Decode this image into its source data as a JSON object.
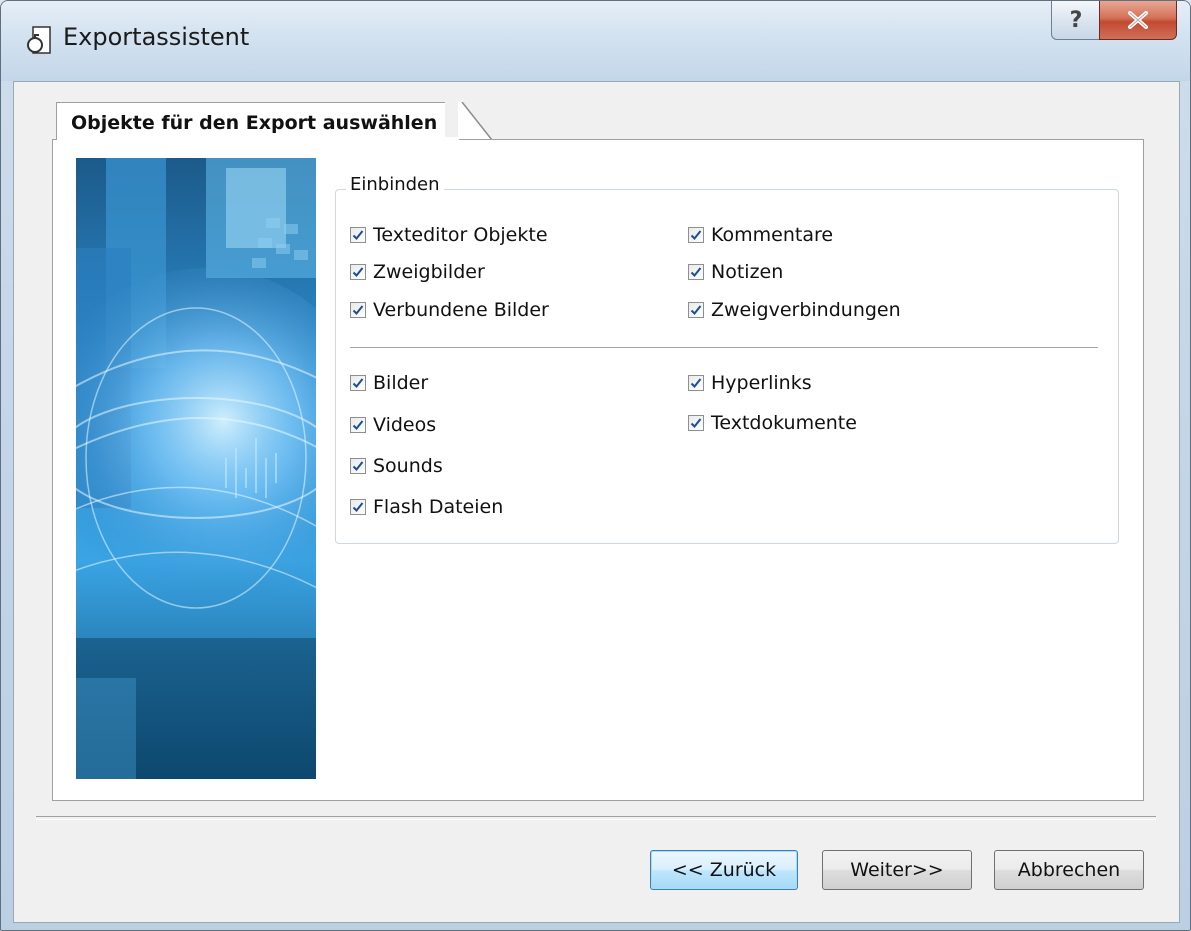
{
  "window": {
    "title": "Exportassistent",
    "help_label": "?",
    "close_label": "X"
  },
  "tab": {
    "label": "Objekte für den Export auswählen"
  },
  "group": {
    "legend": "Einbinden",
    "section1": {
      "left": [
        {
          "label": "Texteditor Objekte",
          "checked": true
        },
        {
          "label": "Zweigbilder",
          "checked": true
        },
        {
          "label": "Verbundene Bilder",
          "checked": true
        }
      ],
      "right": [
        {
          "label": "Kommentare",
          "checked": true
        },
        {
          "label": "Notizen",
          "checked": true
        },
        {
          "label": "Zweigverbindungen",
          "checked": true
        }
      ]
    },
    "section2": {
      "left": [
        {
          "label": "Bilder",
          "checked": true
        },
        {
          "label": "Videos",
          "checked": true
        },
        {
          "label": "Sounds",
          "checked": true
        },
        {
          "label": "Flash Dateien",
          "checked": true
        }
      ],
      "right": [
        {
          "label": "Hyperlinks",
          "checked": true
        },
        {
          "label": "Textdokumente",
          "checked": true
        }
      ]
    }
  },
  "buttons": {
    "back": "<< Zurück",
    "next": "Weiter>>",
    "cancel": "Abbrechen"
  },
  "colors": {
    "accent": "#3c7fb1",
    "checkmark": "#1e4f8a"
  }
}
